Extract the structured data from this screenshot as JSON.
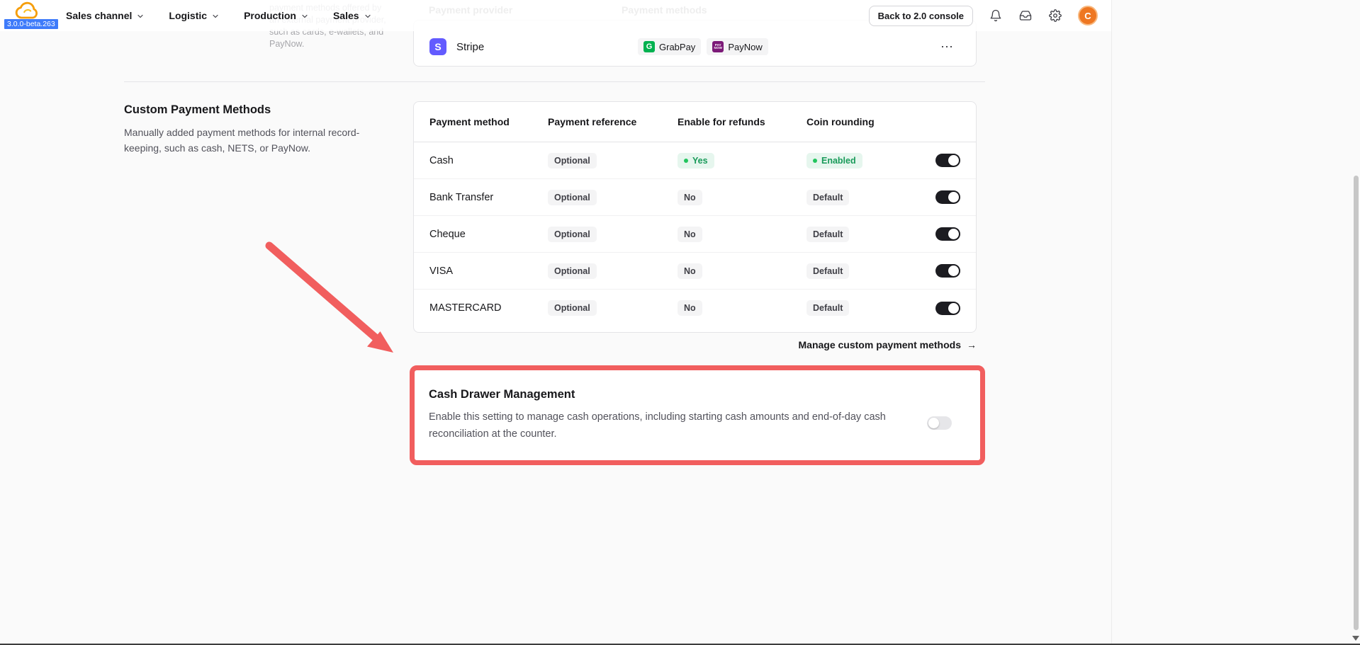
{
  "colors": {
    "accent_red": "#f15e5e",
    "toggle_on": "#1c1c21",
    "toggle_off": "#e6e6e9",
    "badge_green_bg": "#e6f6ee",
    "badge_green_text": "#189a59",
    "badge_gray_bg": "#f4f4f5",
    "stripe_brand": "#635bff",
    "grabpay_green": "#00b14f",
    "paynow_purple": "#7c1a78",
    "version_badge_bg": "#3e7bfa",
    "avatar_bg": "#ee7722"
  },
  "header": {
    "version_badge": "3.0.0-beta.263",
    "nav_items": [
      {
        "label": "Sales channel"
      },
      {
        "label": "Logistic"
      },
      {
        "label": "Production"
      },
      {
        "label": "Sales"
      }
    ],
    "back_button_label": "Back to 2.0 console",
    "avatar_initial": "C"
  },
  "provider_section": {
    "faded_description": "payment methods offered by an external payment provider, such as cards, e-wallets, and PayNow.",
    "col_provider": "Payment provider",
    "col_methods": "Payment methods",
    "row": {
      "name": "Stripe",
      "brand_letter": "S",
      "methods": [
        {
          "label": "GrabPay",
          "logo_text": "G"
        },
        {
          "label": "PayNow",
          "logo_line1": "PAY",
          "logo_line2": "NOW"
        }
      ],
      "actions_glyph": "⋯"
    }
  },
  "custom_section": {
    "title": "Custom Payment Methods",
    "description": "Manually added payment methods for internal record-keeping, such as cash, NETS, or PayNow.",
    "table": {
      "col_method": "Payment method",
      "col_reference": "Payment reference",
      "col_refunds": "Enable for refunds",
      "col_rounding": "Coin rounding",
      "rows": [
        {
          "method": "Cash",
          "reference": "Optional",
          "refunds": "Yes",
          "rounding": "Enabled",
          "toggle_on": true
        },
        {
          "method": "Bank Transfer",
          "reference": "Optional",
          "refunds": "No",
          "rounding": "Default",
          "toggle_on": true
        },
        {
          "method": "Cheque",
          "reference": "Optional",
          "refunds": "No",
          "rounding": "Default",
          "toggle_on": true
        },
        {
          "method": "VISA",
          "reference": "Optional",
          "refunds": "No",
          "rounding": "Default",
          "toggle_on": true
        },
        {
          "method": "MASTERCARD",
          "reference": "Optional",
          "refunds": "No",
          "rounding": "Default",
          "toggle_on": true
        }
      ]
    },
    "manage_link": "Manage custom payment methods",
    "manage_link_arrow": "→"
  },
  "cash_drawer": {
    "title": "Cash Drawer Management",
    "description": "Enable this setting to manage cash operations, including starting cash amounts and end-of-day cash reconciliation at the counter.",
    "toggle_on": false
  }
}
